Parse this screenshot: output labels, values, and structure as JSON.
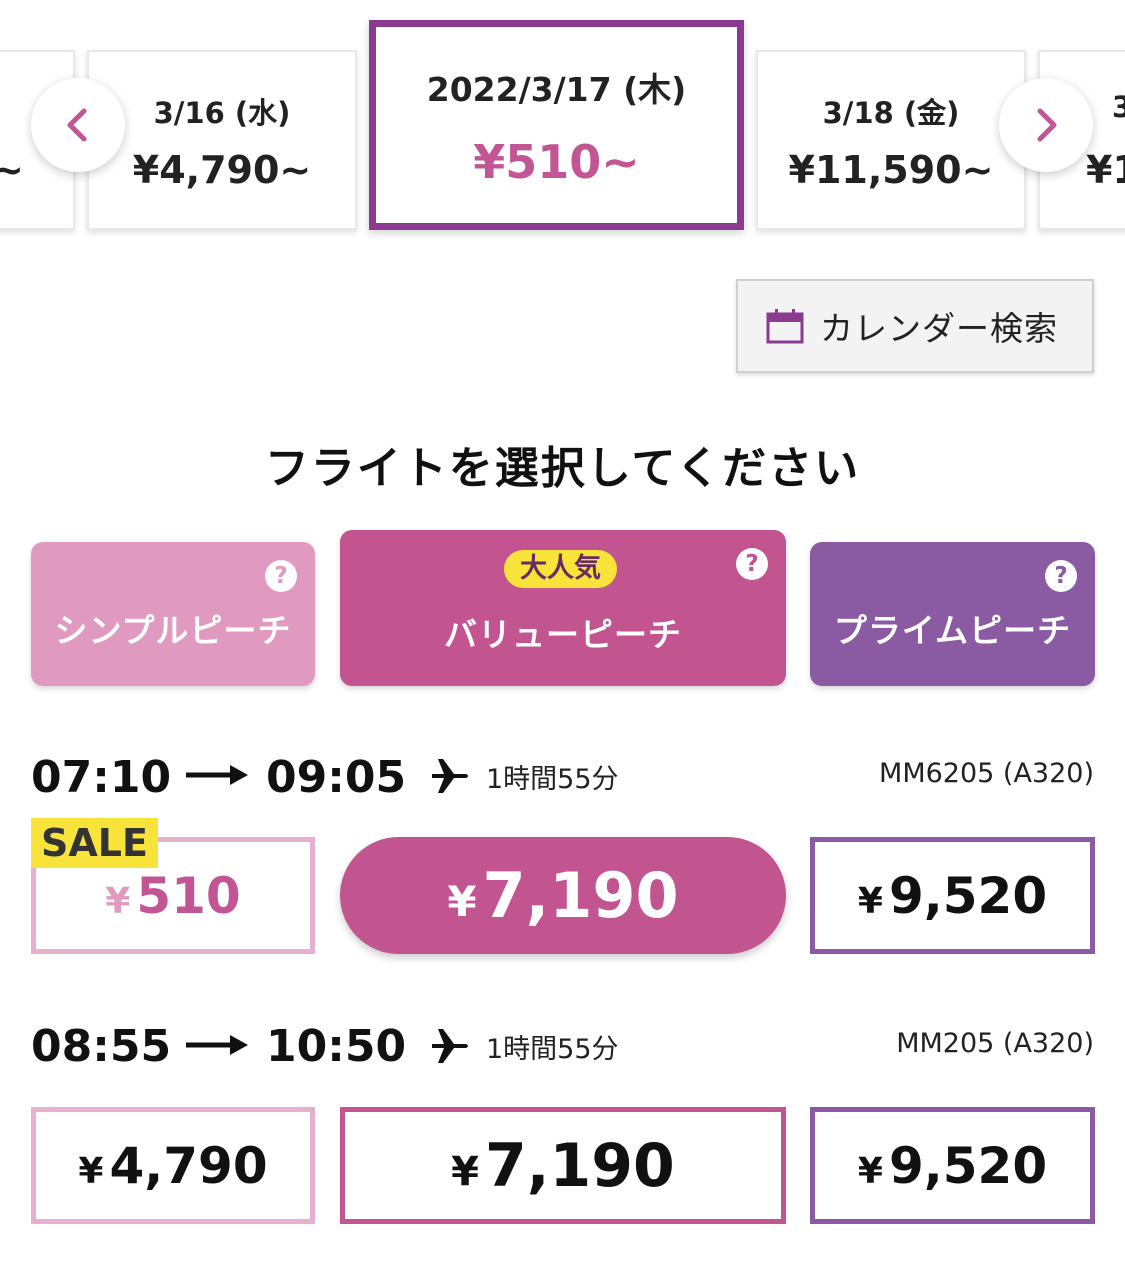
{
  "date_carousel": {
    "prev_partial_price": "~",
    "next_partial_date": "3",
    "next_partial_price": "¥1",
    "dates": [
      {
        "date": "3/16 (水)",
        "price": "¥4,790~"
      },
      {
        "date": "2022/3/17 (木)",
        "price": "¥510~"
      },
      {
        "date": "3/18 (金)",
        "price": "¥11,590~"
      }
    ],
    "prev_icon": "chevron-left",
    "next_icon": "chevron-right"
  },
  "calendar_search": {
    "icon": "calendar",
    "label": "カレンダー検索"
  },
  "heading": "フライトを選択してください",
  "fare_tabs": [
    {
      "name": "シンプルピーチ",
      "help": "?",
      "color": "#e09ac0"
    },
    {
      "name": "バリューピーチ",
      "help": "?",
      "badge": "大人気",
      "color": "#c25590"
    },
    {
      "name": "プライムピーチ",
      "help": "?",
      "color": "#8a5aa3"
    }
  ],
  "flights": [
    {
      "depart": "07:10",
      "arrive": "09:05",
      "duration": "1時間55分",
      "flight_no": "MM6205 (A320)",
      "prices": {
        "simple": "510",
        "value": "7,190",
        "prime": "9,520"
      },
      "simple_sale": "SALE",
      "selected_fare": "value"
    },
    {
      "depart": "08:55",
      "arrive": "10:50",
      "duration": "1時間55分",
      "flight_no": "MM205 (A320)",
      "prices": {
        "simple": "4,790",
        "value": "7,190",
        "prime": "9,520"
      }
    }
  ],
  "yen_symbol": "¥",
  "colors": {
    "accent": "#8a3a8f",
    "pink": "#c25590",
    "light_pink": "#e09ac0",
    "purple": "#8a5aa3",
    "sale": "#f7e33a"
  }
}
